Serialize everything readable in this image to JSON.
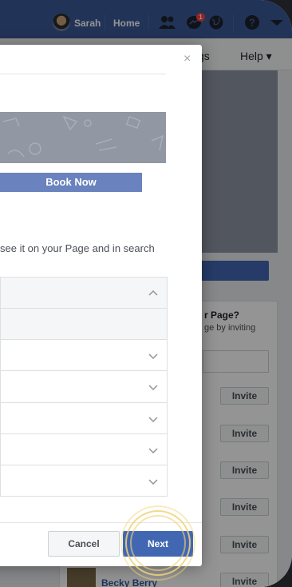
{
  "navbar": {
    "user_name": "Sarah",
    "home_label": "Home",
    "messages_badge": "1",
    "colors": {
      "bar": "#3b5998",
      "badge": "#fa3e3e"
    }
  },
  "subbar": {
    "settings_label": "gs",
    "help_label": "Help ▾"
  },
  "side_card": {
    "title": "r Page?",
    "subtitle": "ge by inviting",
    "invite_label": "Invite",
    "invite_count": 6,
    "friend_name": "Becky Berry"
  },
  "modal": {
    "close_glyph": "×",
    "preview_button": "Book Now",
    "description": "see it on your Page and in search",
    "accordion_rows": 7,
    "cancel_label": "Cancel",
    "next_label": "Next",
    "colors": {
      "primary": "#4267b2",
      "preview_button": "#6a82bd"
    }
  }
}
